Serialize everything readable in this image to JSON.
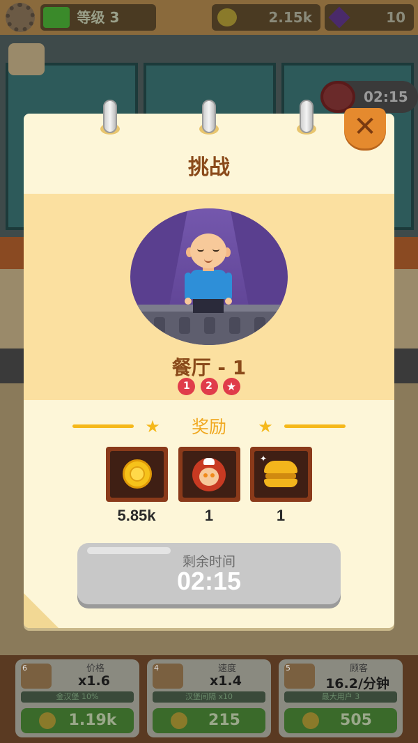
{
  "hud": {
    "level_label": "等级 3",
    "coins": "2.15k",
    "gems": "10",
    "event_timer": "02:15"
  },
  "upgrades": [
    {
      "num": "6",
      "title": "价格",
      "value": "x1.6",
      "sub": "金汉堡 10%",
      "cost": "1.19k"
    },
    {
      "num": "4",
      "title": "速度",
      "value": "x1.4",
      "sub": "汉堡间隔 x10",
      "cost": "215"
    },
    {
      "num": "5",
      "title": "顾客",
      "value": "16.2/分钟",
      "sub": "最大用户 3",
      "cost": "505"
    }
  ],
  "dialog": {
    "title": "挑战",
    "close_symbol": "✕",
    "restaurant_label": "餐厅 - 1",
    "stages": [
      "1",
      "2",
      "★"
    ],
    "reward_title": "奖励",
    "rewards": [
      {
        "icon": "gold-coin-icon",
        "value": "5.85k"
      },
      {
        "icon": "chef-avatar-icon",
        "value": "1"
      },
      {
        "icon": "golden-burger-icon",
        "value": "1"
      }
    ],
    "timer_label": "剩余时间",
    "timer_value": "02:15"
  },
  "colors": {
    "dialog_bg": "#fdf6d8",
    "hero_band": "#fbe0a0",
    "title_brown": "#8a4a1a",
    "reward_gold": "#f0a820",
    "close_orange": "#e58a2e",
    "stage_red": "#e03c4a"
  }
}
